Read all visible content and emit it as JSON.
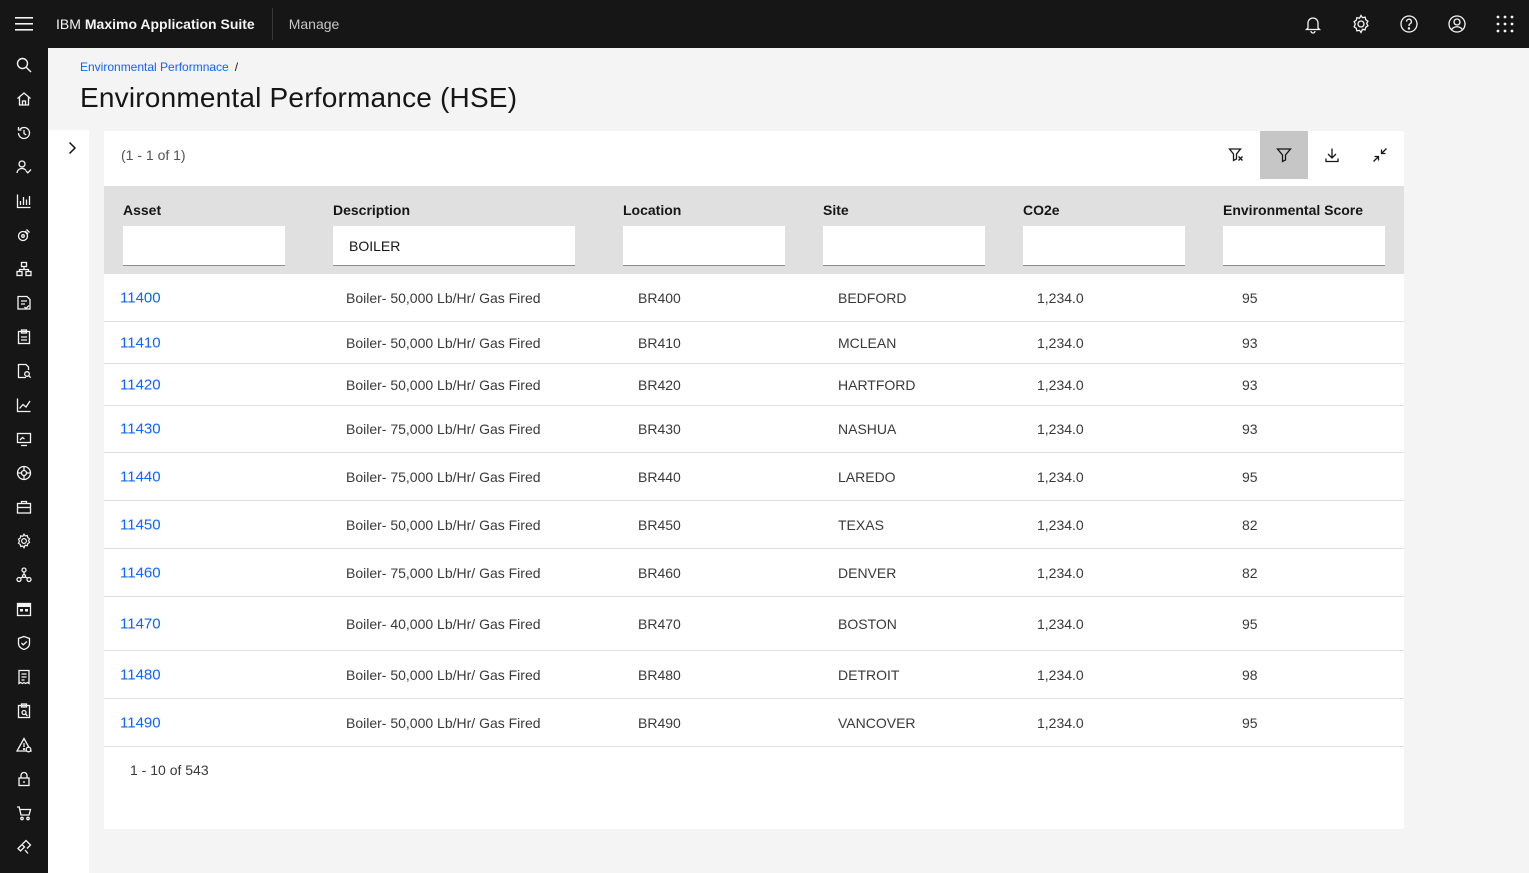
{
  "header": {
    "brand_prefix": "IBM",
    "brand_name": "Maximo Application Suite",
    "app_name": "Manage",
    "icons": [
      "notification-icon",
      "settings-icon",
      "help-icon",
      "user-icon",
      "app-switcher-icon"
    ]
  },
  "sidenav": {
    "icons": [
      "search-icon",
      "home-icon",
      "recent-icon",
      "user-check-icon",
      "chart-bar-icon",
      "satellite-icon",
      "network-icon",
      "data-check-icon",
      "clipboard-icon",
      "document-search-icon",
      "chart-line-icon",
      "monitor-icon",
      "globe-icon",
      "briefcase-icon",
      "gear-icon",
      "hierarchy-icon",
      "calendar-icon",
      "shield-icon",
      "receipt-icon",
      "report-icon",
      "warning-icon",
      "lock-icon",
      "cart-icon",
      "tools-icon"
    ]
  },
  "breadcrumb": {
    "item": "Environmental Performnace",
    "separator": "/"
  },
  "page": {
    "title": "Environmental Performance (HSE)"
  },
  "table": {
    "range_label": "(1 - 1 of 1)",
    "columns": [
      {
        "label": "Asset",
        "filter": ""
      },
      {
        "label": "Description",
        "filter": "BOILER"
      },
      {
        "label": "Location",
        "filter": ""
      },
      {
        "label": "Site",
        "filter": ""
      },
      {
        "label": "CO2e",
        "filter": ""
      },
      {
        "label": "Environmental Score",
        "filter": ""
      }
    ],
    "rows": [
      {
        "asset": "11400",
        "description": "Boiler- 50,000 Lb/Hr/ Gas Fired",
        "location": "BR400",
        "site": "BEDFORD",
        "co2e": "1,234.0",
        "score": "95"
      },
      {
        "asset": "11410",
        "description": "Boiler- 50,000 Lb/Hr/ Gas Fired",
        "location": "BR410",
        "site": "MCLEAN",
        "co2e": "1,234.0",
        "score": "93"
      },
      {
        "asset": "11420",
        "description": "Boiler- 50,000 Lb/Hr/ Gas Fired",
        "location": "BR420",
        "site": "HARTFORD",
        "co2e": "1,234.0",
        "score": "93"
      },
      {
        "asset": "11430",
        "description": "Boiler- 75,000 Lb/Hr/ Gas Fired",
        "location": "BR430",
        "site": "NASHUA",
        "co2e": "1,234.0",
        "score": "93"
      },
      {
        "asset": "11440",
        "description": "Boiler- 75,000 Lb/Hr/ Gas Fired",
        "location": "BR440",
        "site": "LAREDO",
        "co2e": "1,234.0",
        "score": "95"
      },
      {
        "asset": "11450",
        "description": "Boiler- 50,000 Lb/Hr/ Gas Fired",
        "location": "BR450",
        "site": "TEXAS",
        "co2e": "1,234.0",
        "score": "82"
      },
      {
        "asset": "11460",
        "description": "Boiler- 75,000 Lb/Hr/ Gas Fired",
        "location": "BR460",
        "site": "DENVER",
        "co2e": "1,234.0",
        "score": "82"
      },
      {
        "asset": "11470",
        "description": "Boiler- 40,000 Lb/Hr/ Gas Fired",
        "location": "BR470",
        "site": "BOSTON",
        "co2e": "1,234.0",
        "score": "95"
      },
      {
        "asset": "11480",
        "description": "Boiler- 50,000 Lb/Hr/ Gas Fired",
        "location": "BR480",
        "site": "DETROIT",
        "co2e": "1,234.0",
        "score": "98"
      },
      {
        "asset": "11490",
        "description": "Boiler- 50,000 Lb/Hr/ Gas Fired",
        "location": "BR490",
        "site": "VANCOVER",
        "co2e": "1,234.0",
        "score": "95"
      }
    ],
    "pagination": "1 - 10 of 543"
  },
  "toolbar": {
    "icons": [
      "clear-filter-icon",
      "filter-icon",
      "download-icon",
      "minimize-icon"
    ]
  },
  "colors": {
    "header_bg": "#161616",
    "link": "#0f62fe",
    "table_header_bg": "#e0e0e0",
    "active_tool_bg": "#c6c6c6"
  }
}
